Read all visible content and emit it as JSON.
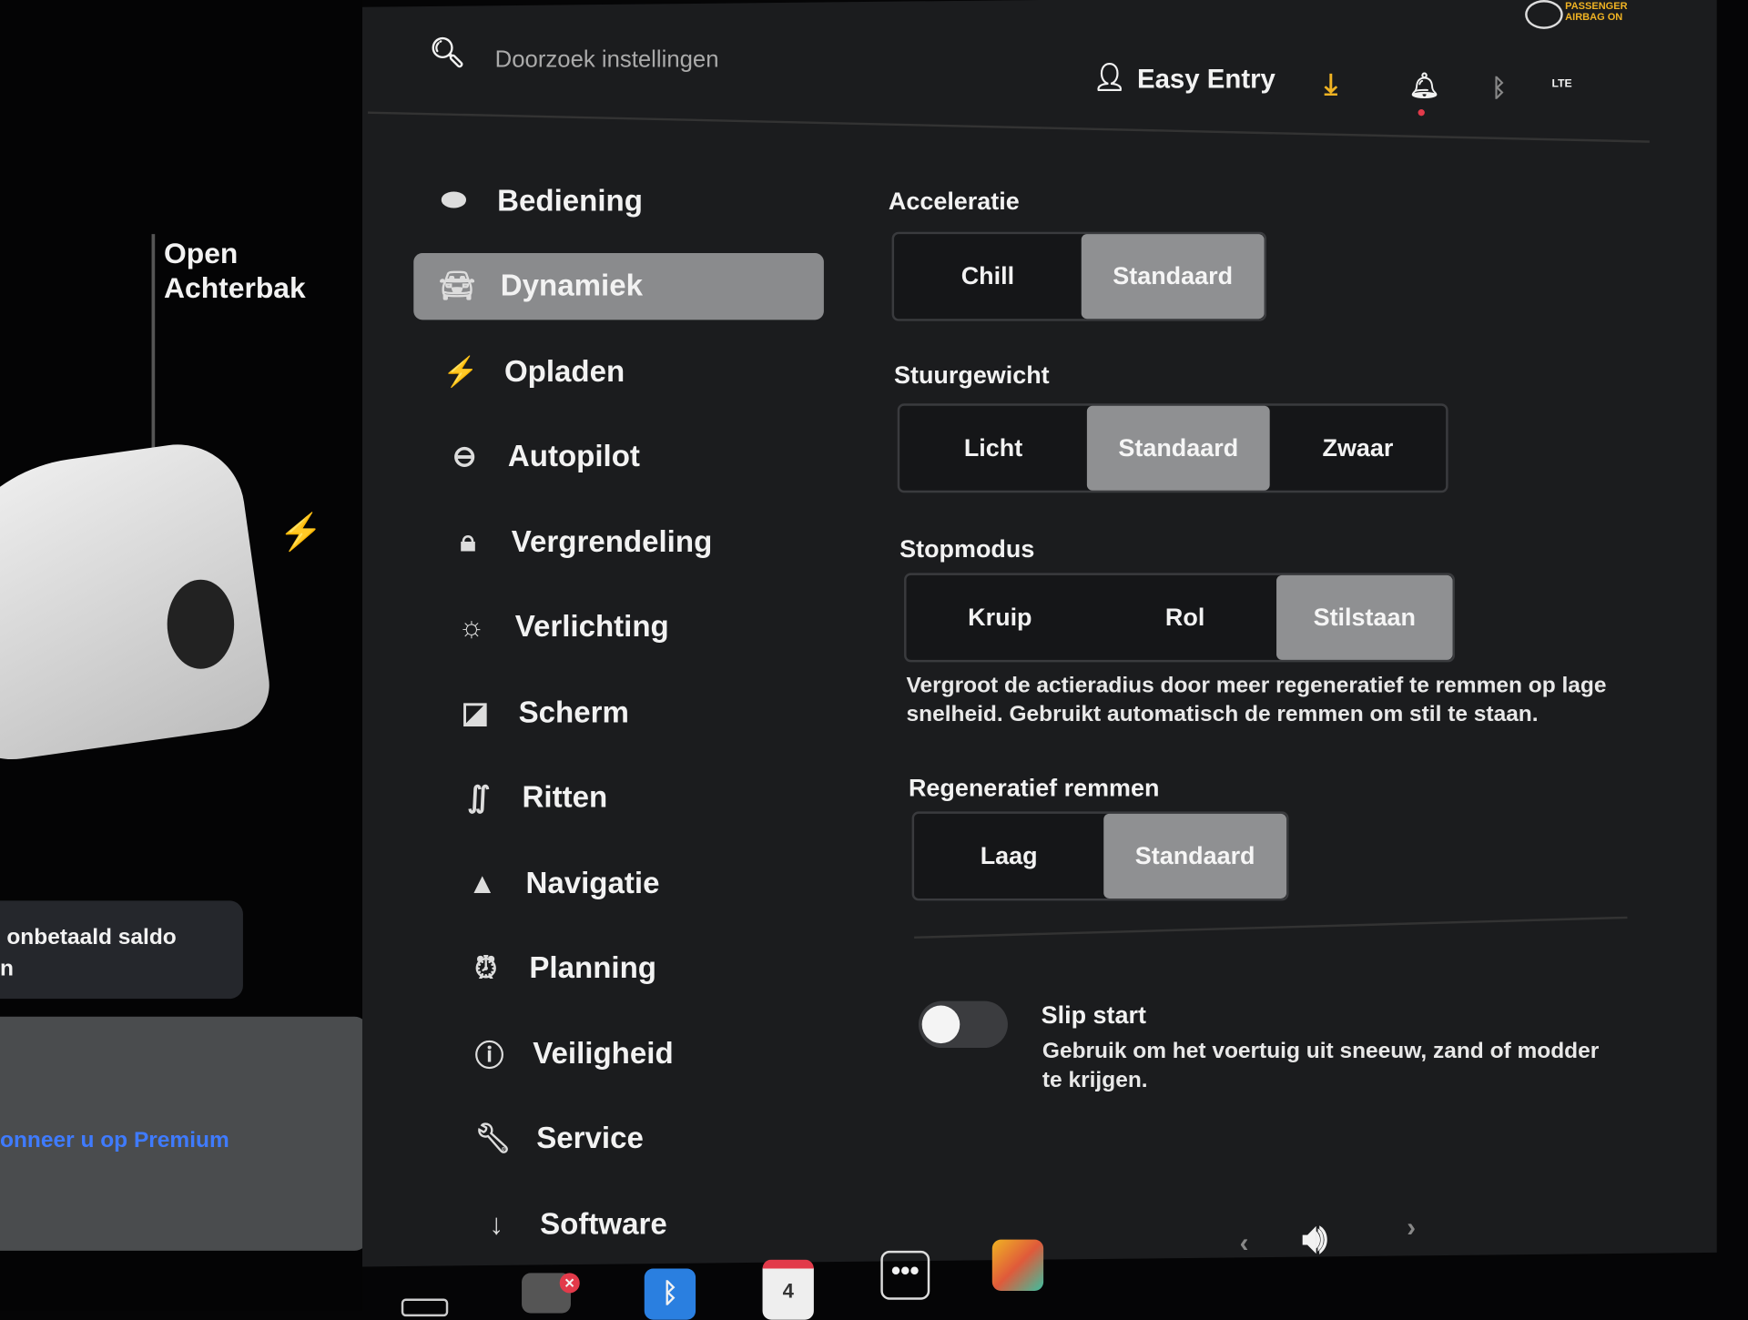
{
  "header": {
    "search_placeholder": "Doorzoek instellingen",
    "profile": "Easy Entry",
    "airbag": "PASSENGER AIRBAG ON",
    "lte": "LTE"
  },
  "left": {
    "trunk_line1": "Open",
    "trunk_line2": "Achterbak",
    "notice": "onbetaald saldo",
    "notice2": "n",
    "premium": "onneer u op Premium"
  },
  "sidebar": {
    "items": [
      {
        "label": "Bediening",
        "icon": "toggle-icon"
      },
      {
        "label": "Dynamiek",
        "icon": "car-icon",
        "active": true
      },
      {
        "label": "Opladen",
        "icon": "bolt-icon"
      },
      {
        "label": "Autopilot",
        "icon": "steering-wheel-icon"
      },
      {
        "label": "Vergrendeling",
        "icon": "lock-icon"
      },
      {
        "label": "Verlichting",
        "icon": "sun-icon"
      },
      {
        "label": "Scherm",
        "icon": "display-icon"
      },
      {
        "label": "Ritten",
        "icon": "trips-icon"
      },
      {
        "label": "Navigatie",
        "icon": "navigation-icon"
      },
      {
        "label": "Planning",
        "icon": "alarm-clock-icon"
      },
      {
        "label": "Veiligheid",
        "icon": "alert-circle-icon"
      },
      {
        "label": "Service",
        "icon": "wrench-icon"
      },
      {
        "label": "Software",
        "icon": "download-icon"
      }
    ]
  },
  "settings": {
    "acceleratie": {
      "title": "Acceleratie",
      "options": [
        "Chill",
        "Standaard"
      ],
      "selected": "Standaard"
    },
    "stuurgewicht": {
      "title": "Stuurgewicht",
      "options": [
        "Licht",
        "Standaard",
        "Zwaar"
      ],
      "selected": "Standaard"
    },
    "stopmodus": {
      "title": "Stopmodus",
      "options": [
        "Kruip",
        "Rol",
        "Stilstaan"
      ],
      "selected": "Stilstaan",
      "description": "Vergroot de actieradius door meer regeneratief te remmen op lage snelheid. Gebruikt automatisch de remmen om stil te staan."
    },
    "regeneratief": {
      "title": "Regeneratief remmen",
      "options": [
        "Laag",
        "Standaard"
      ],
      "selected": "Standaard"
    },
    "slip_start": {
      "title": "Slip start",
      "description": "Gebruik om het voertuig uit sneeuw, zand of modder te krijgen.",
      "enabled": false
    }
  },
  "taskbar": {
    "calendar_day": "4"
  },
  "colors": {
    "accent_download": "#f0b323",
    "notification_dot": "#e23a4a",
    "selected": "#8f9092",
    "link": "#3f7bff"
  }
}
